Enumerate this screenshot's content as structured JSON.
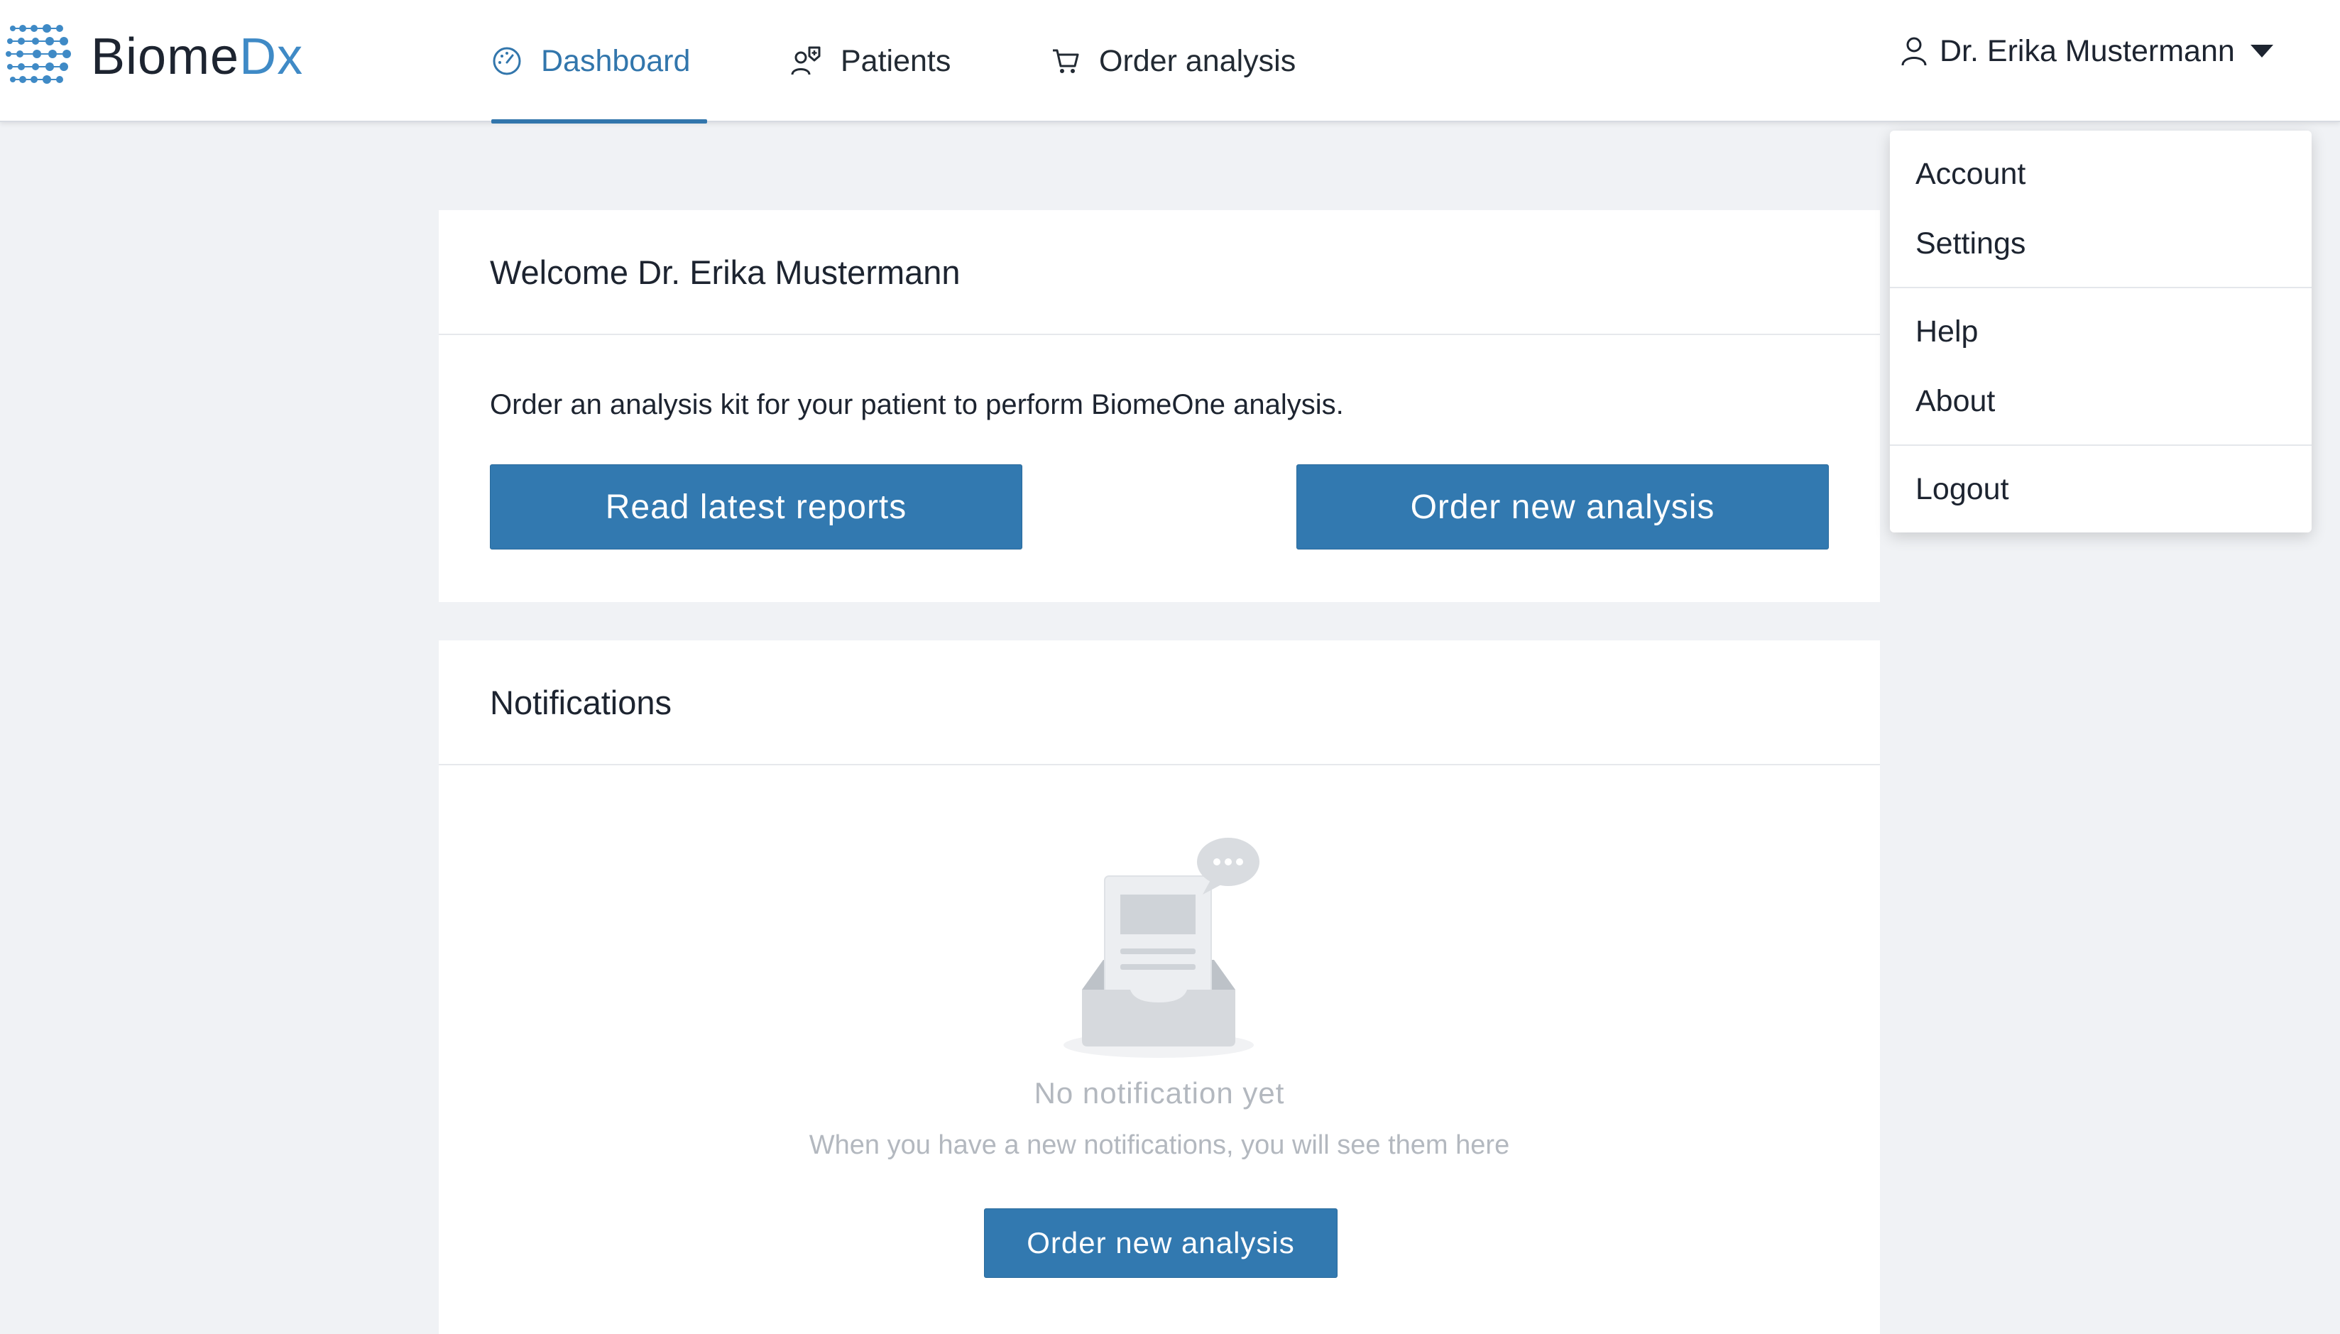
{
  "brand": {
    "name_part1": "Biome",
    "name_part2": "Dx",
    "logo_icon": "dna-dots-icon"
  },
  "nav": {
    "items": [
      {
        "label": "Dashboard",
        "icon": "gauge-icon",
        "active": true
      },
      {
        "label": "Patients",
        "icon": "patients-icon",
        "active": false
      },
      {
        "label": "Order analysis",
        "icon": "cart-icon",
        "active": false
      }
    ]
  },
  "user_menu": {
    "name": "Dr. Erika Mustermann",
    "icon": "user-icon",
    "dropdown": {
      "group1": [
        "Account",
        "Settings"
      ],
      "group2": [
        "Help",
        "About"
      ],
      "group3": [
        "Logout"
      ]
    }
  },
  "welcome": {
    "title": "Welcome Dr. Erika Mustermann",
    "intro": "Order an analysis kit for your patient to perform BiomeOne analysis.",
    "read_reports_label": "Read latest reports",
    "order_label": "Order new analysis"
  },
  "notifications": {
    "title": "Notifications",
    "empty_icon": "empty-inbox-icon",
    "empty_title": "No notification yet",
    "empty_subtitle": "When you have a new notifications, you will see them here",
    "order_label": "Order new analysis"
  },
  "colors": {
    "accent": "#3279b0",
    "brand_blue": "#3f8ac6",
    "background": "#f0f2f5"
  }
}
